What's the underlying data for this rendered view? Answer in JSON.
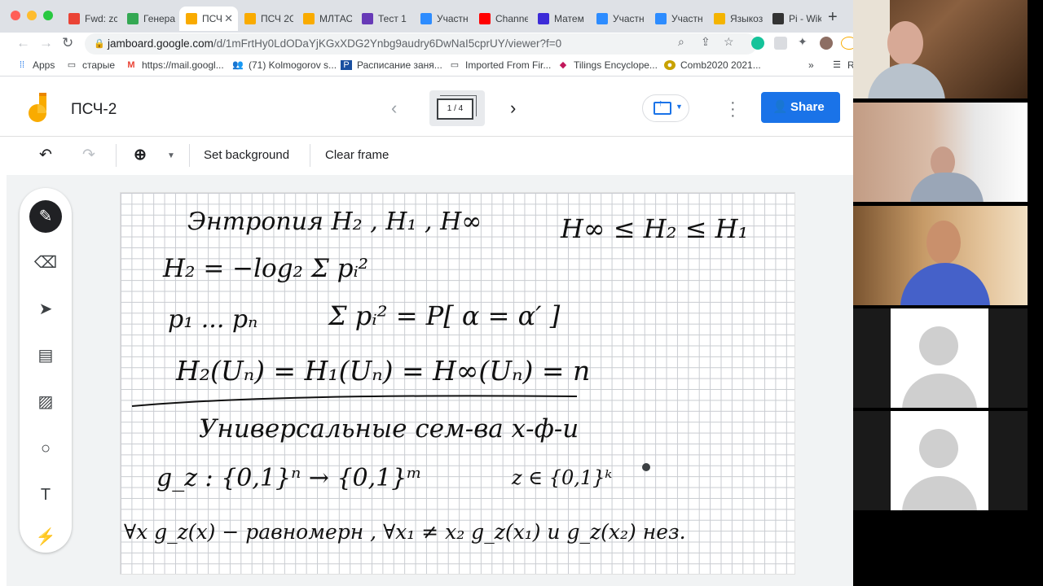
{
  "browser": {
    "tabs": [
      {
        "label": "Fwd: zc",
        "icon": "gmail-icon",
        "color": "#ea4335"
      },
      {
        "label": "Генера",
        "icon": "drive-icon",
        "color": "#34a853"
      },
      {
        "label": "ПСЧ",
        "icon": "jamboard-icon",
        "color": "#f9ab00",
        "active": true
      },
      {
        "label": "ПСЧ 2С",
        "icon": "jamboard-icon",
        "color": "#f9ab00"
      },
      {
        "label": "МЛТАС",
        "icon": "jamboard-icon",
        "color": "#f9ab00"
      },
      {
        "label": "Тест 1",
        "icon": "forms-icon",
        "color": "#673ab7"
      },
      {
        "label": "Участн",
        "icon": "zoom-icon",
        "color": "#2d8cff"
      },
      {
        "label": "Channe",
        "icon": "youtube-icon",
        "color": "#ff0000"
      },
      {
        "label": "Матем",
        "icon": "ampersand-icon",
        "color": "#3c2bd8"
      },
      {
        "label": "Участн",
        "icon": "zoom-icon",
        "color": "#2d8cff"
      },
      {
        "label": "Участн",
        "icon": "zoom-icon",
        "color": "#2d8cff"
      },
      {
        "label": "Языкоз",
        "icon": "slides-icon",
        "color": "#f4b400"
      },
      {
        "label": "Pi - Wik",
        "icon": "wikipedia-icon",
        "color": "#333333"
      }
    ],
    "url_host": "jamboard.google.com",
    "url_path": "/d/1mFrtHy0LdODaYjKGxXDG2Ynbg9audry6DwNaI5cprUY/viewer?f=0",
    "bookmarks": [
      {
        "label": "Apps"
      },
      {
        "label": "старые"
      },
      {
        "label": "https://mail.googl..."
      },
      {
        "label": "(71) Kolmogorov s..."
      },
      {
        "label": "Расписание заня..."
      },
      {
        "label": "Imported From Fir..."
      },
      {
        "label": "Tilings Encyclope..."
      },
      {
        "label": "Comb2020 2021..."
      }
    ],
    "bookmarks_more": "»",
    "bookmarks_reading": "R"
  },
  "jamboard": {
    "title": "ПСЧ-2",
    "frame_indicator": "1 / 4",
    "share_label": "Share",
    "toolbar": {
      "set_background": "Set background",
      "clear_frame": "Clear frame"
    }
  },
  "board_lines": {
    "l1a": "Энтропия  H₂ , H₁ , H∞",
    "l1b": "H∞ ≤ H₂ ≤ H₁",
    "l2": "H₂ = −log₂ Σ pᵢ²",
    "l3a": "p₁ ... pₙ",
    "l3b": "Σ pᵢ² = P[ α = α′ ]",
    "l4": "H₂(Uₙ) = H₁(Uₙ) = H∞(Uₙ) = n",
    "l5": "Универсальные сем-ва   х-ф-и",
    "l6a": "g_z : {0,1}ⁿ → {0,1}ᵐ",
    "l6b": "z ∈ {0,1}ᵏ",
    "l7": "∀x g_z(x) − равномерн ,  ∀x₁ ≠ x₂   g_z(x₁) и g_z(x₂) нез."
  },
  "colors": {
    "accent": "#1a73e8",
    "jamboard_yellow": "#f9ab00"
  }
}
